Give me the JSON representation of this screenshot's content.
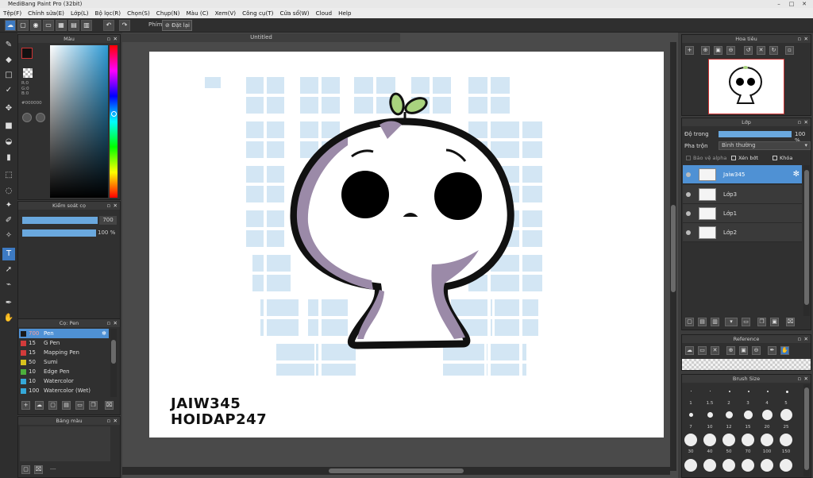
{
  "window": {
    "title": "MediBang Paint Pro (32bit)"
  },
  "menu": [
    "Tệp(F)",
    "Chỉnh sửa(E)",
    "Lớp(L)",
    "Bộ lọc(R)",
    "Chọn(S)",
    "Chụp(N)",
    "Màu (C)",
    "Xem(V)",
    "Công cụ(T)",
    "Cửa sổ(W)",
    "Cloud",
    "Help"
  ],
  "toolbar": {
    "shortcut_label": "Phím",
    "reset_label": "Đặt lại"
  },
  "color_panel": {
    "title": "Màu",
    "r": "R:0",
    "g": "G:0",
    "b": "B:0",
    "hex": "#000000",
    "fg": "#111111",
    "bg": "#ffffff"
  },
  "brush_control": {
    "title": "Kiểm soát cọ",
    "size_value": "700",
    "opacity_value": "100 %"
  },
  "brush_panel": {
    "title": "Cọ: Pen",
    "items": [
      {
        "size": "700",
        "name": "Pen",
        "color": "#1a1a1a"
      },
      {
        "size": "15",
        "name": "G Pen",
        "color": "#d23b3b"
      },
      {
        "size": "15",
        "name": "Mapping Pen",
        "color": "#d23b3b"
      },
      {
        "size": "50",
        "name": "Sumi",
        "color": "#d8c21e"
      },
      {
        "size": "10",
        "name": "Edge Pen",
        "color": "#4caf3c"
      },
      {
        "size": "10",
        "name": "Watercolor",
        "color": "#35a8d8"
      },
      {
        "size": "100",
        "name": "Watercolor (Wet)",
        "color": "#35a8d8"
      }
    ]
  },
  "palette_panel": {
    "title": "Bảng màu",
    "footer": "---"
  },
  "canvas": {
    "tab_title": "Untitled",
    "signature_line1": "JAIW345",
    "signature_line2": "HOIDAP247"
  },
  "navigator": {
    "title": "Hoa tiêu"
  },
  "layer_panel": {
    "title": "Lớp",
    "opacity_label": "Độ trong",
    "opacity_value": "100 %",
    "blend_label": "Pha trộn",
    "blend_value": "Bình thường",
    "protect_alpha": "Bảo vệ alpha",
    "clipping": "Xén bớt",
    "lock": "Khóa",
    "layers": [
      {
        "name": "Jaiw345",
        "selected": true
      },
      {
        "name": "Lớp3",
        "selected": false
      },
      {
        "name": "Lớp1",
        "selected": false
      },
      {
        "name": "Lớp2",
        "selected": false
      }
    ]
  },
  "reference_panel": {
    "title": "Reference"
  },
  "brush_size_panel": {
    "title": "Brush Size",
    "rows": [
      [
        "1",
        "1.5",
        "2",
        "3",
        "4",
        "5"
      ],
      [
        "7",
        "10",
        "12",
        "15",
        "20",
        "25"
      ],
      [
        "30",
        "40",
        "50",
        "70",
        "100",
        "150"
      ]
    ]
  }
}
